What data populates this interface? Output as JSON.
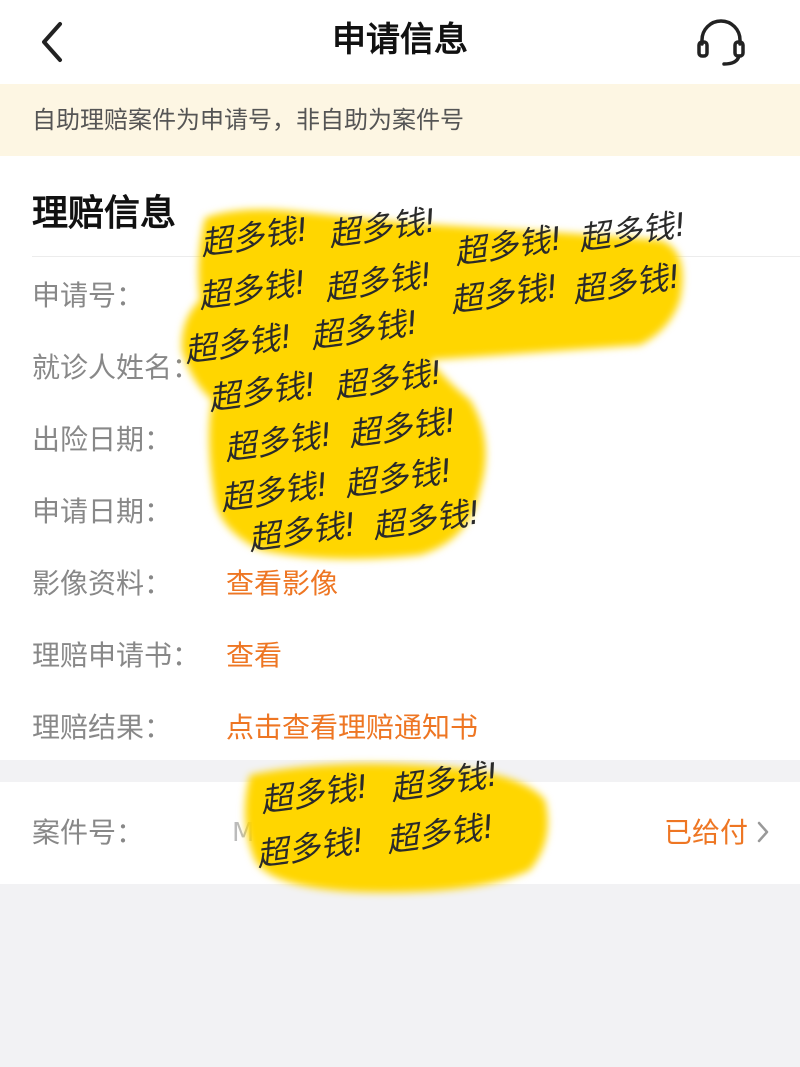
{
  "header": {
    "title": "申请信息",
    "back_icon": "chevron-left-icon",
    "service_icon": "headset-icon"
  },
  "notice": {
    "text": "自助理赔案件为申请号，非自助为案件号"
  },
  "claim_info": {
    "title": "理赔信息",
    "fields": [
      {
        "label": "申请号："
      },
      {
        "label": "就诊人姓名："
      },
      {
        "label": "出险日期："
      },
      {
        "label": "申请日期："
      },
      {
        "label": "影像资料：",
        "link": "查看影像"
      },
      {
        "label": "理赔申请书：",
        "link": "查看"
      },
      {
        "label": "理赔结果：",
        "link": "点击查看理赔通知书"
      }
    ]
  },
  "case": {
    "label": "案件号：",
    "value_partial": "M",
    "status": "已给付"
  },
  "redaction": {
    "text": "超多钱!",
    "color": "#ffd600"
  },
  "colors": {
    "accent": "#ee7623",
    "notice_bg": "#fdf6e3",
    "page_bg": "#f2f2f4"
  }
}
